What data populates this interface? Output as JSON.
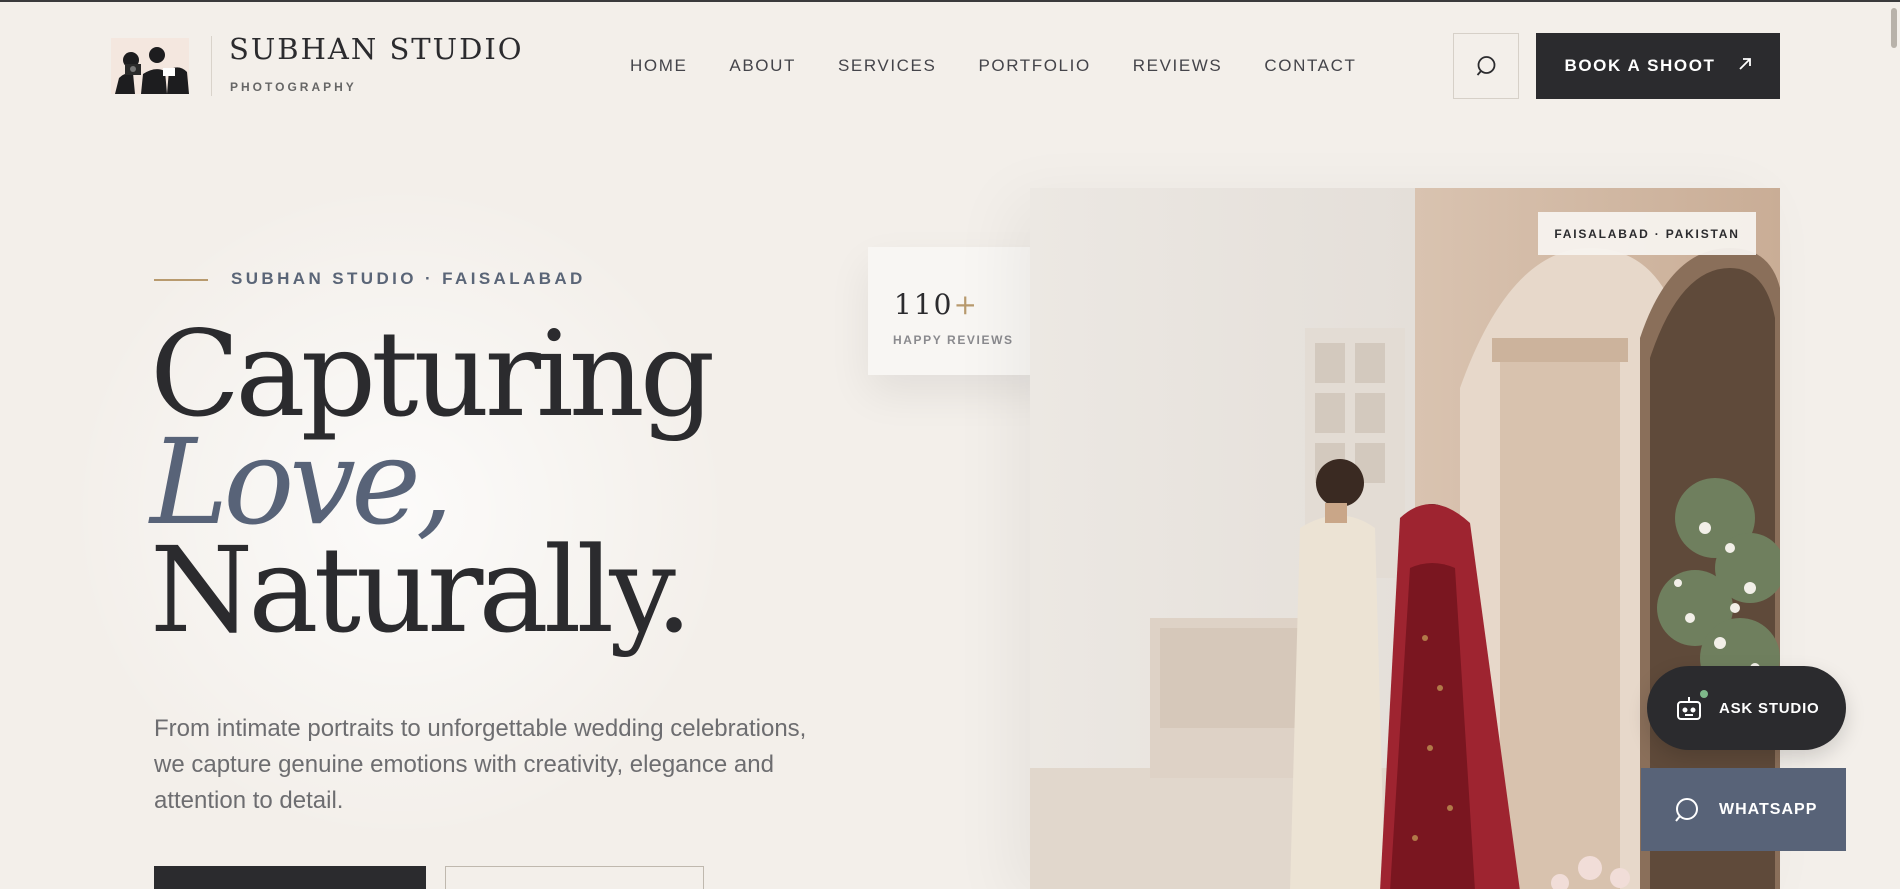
{
  "brand": {
    "name": "SUBHAN STUDIO",
    "tagline": "PHOTOGRAPHY"
  },
  "nav": {
    "items": [
      "HOME",
      "ABOUT",
      "SERVICES",
      "PORTFOLIO",
      "REVIEWS",
      "CONTACT"
    ]
  },
  "header": {
    "search_icon": "search-chat-icon",
    "book_label": "BOOK A SHOOT",
    "book_icon": "arrow-up-right-icon"
  },
  "hero": {
    "eyebrow": "SUBHAN STUDIO · FAISALABAD",
    "headline_1": "Capturing",
    "headline_2": "Love,",
    "headline_3": "Naturally.",
    "description": "From intimate portraits to unforgettable wedding celebrations, we capture genuine emotions with creativity, elegance and attention to detail."
  },
  "stat": {
    "value": "110",
    "suffix": "+",
    "label": "HAPPY REVIEWS"
  },
  "photo": {
    "location": "FAISALABAD · PAKISTAN"
  },
  "floating": {
    "ask_label": "ASK STUDIO",
    "whatsapp_label": "WHATSAPP",
    "ask_icon": "robot-icon",
    "whatsapp_icon": "chat-bubble-icon"
  },
  "colors": {
    "dark": "#2b2b2e",
    "accent_slate": "#586378",
    "gold": "#b89a6e",
    "background": "#f3efea"
  }
}
